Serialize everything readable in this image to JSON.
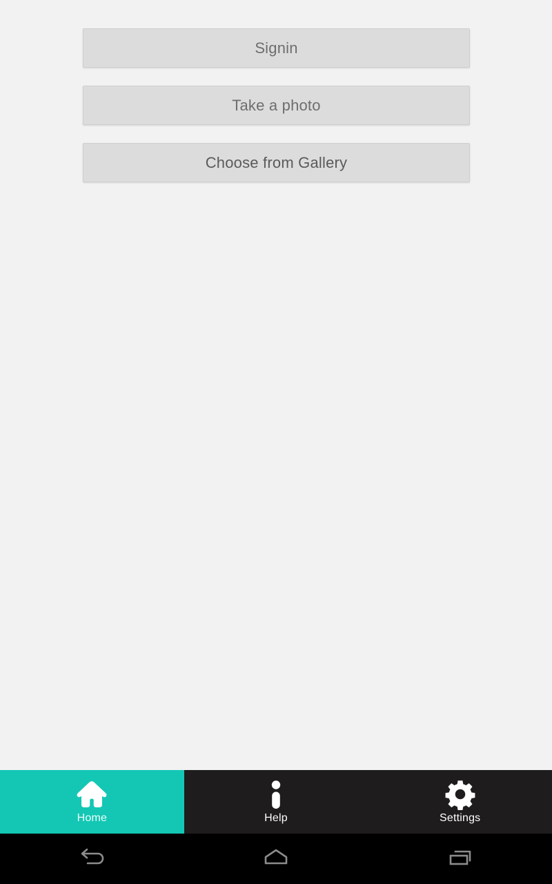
{
  "theme": {
    "page_background": "#f2f2f2",
    "button_fill": "#dcdcdc",
    "button_border": "#cfcfcf",
    "button_text": "#6e6e6e",
    "accent_teal": "#13c7b4",
    "tabbar_background": "#1e1c1c",
    "sysnav_background": "#000000",
    "tab_label_color": "#ffffff",
    "sysnav_icon_color": "#8c8c8c"
  },
  "main": {
    "buttons": [
      {
        "label": "Signin",
        "icon": "signin-button"
      },
      {
        "label": "Take a photo",
        "icon": "camera-button"
      },
      {
        "label": "Choose from Gallery",
        "icon": "gallery-button"
      }
    ]
  },
  "tabbar": {
    "items": [
      {
        "label": "Home",
        "icon": "home-icon",
        "active": true
      },
      {
        "label": "Help",
        "icon": "info-icon",
        "active": false
      },
      {
        "label": "Settings",
        "icon": "gear-icon",
        "active": false
      }
    ]
  },
  "sysnav": {
    "buttons": [
      {
        "name": "back-icon"
      },
      {
        "name": "home-icon"
      },
      {
        "name": "recents-icon"
      }
    ]
  }
}
